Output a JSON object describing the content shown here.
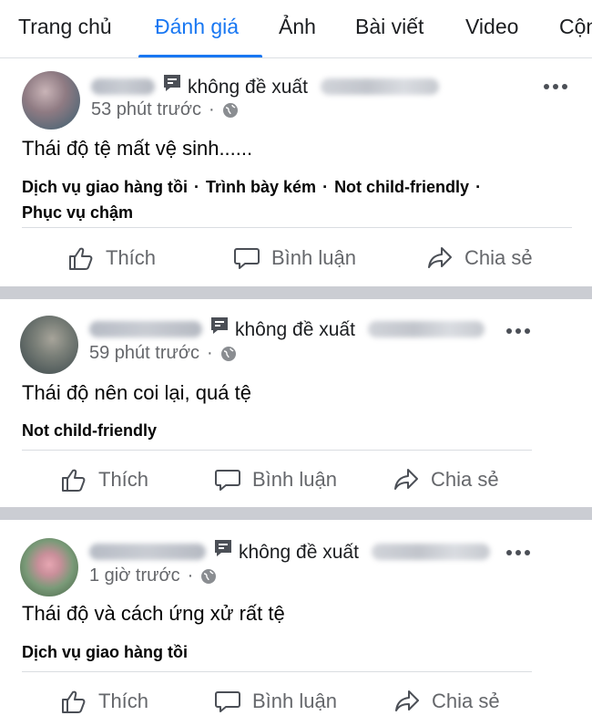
{
  "tabs": [
    {
      "label": "Trang chủ"
    },
    {
      "label": "Đánh giá",
      "active": true
    },
    {
      "label": "Ảnh"
    },
    {
      "label": "Bài viết"
    },
    {
      "label": "Video"
    },
    {
      "label": "Cộn"
    }
  ],
  "colors": {
    "accent": "#1877f2",
    "separator": "#cbcdd3",
    "secondary_text": "#65676b"
  },
  "posts": [
    {
      "recommendation": "không đề xuất",
      "time": "53 phút trước",
      "text": "Thái độ tệ mất vệ sinh......",
      "tags": [
        "Dịch vụ giao hàng tồi",
        "Trình bày kém",
        "Not child-friendly",
        "Phục vụ chậm"
      ],
      "actions": {
        "like": "Thích",
        "comment": "Bình luận",
        "share": "Chia sẻ"
      }
    },
    {
      "recommendation": "không đề xuất",
      "time": "59 phút trước",
      "text": "Thái độ nên coi lại, quá tệ",
      "tags": [
        "Not child-friendly"
      ],
      "actions": {
        "like": "Thích",
        "comment": "Bình luận",
        "share": "Chia sẻ"
      }
    },
    {
      "recommendation": "không đề xuất",
      "time": "1 giờ trước",
      "text": "Thái độ và cách ứng xử rất tệ",
      "tags": [
        "Dịch vụ giao hàng tồi"
      ],
      "actions": {
        "like": "Thích",
        "comment": "Bình luận",
        "share": "Chia sẻ"
      }
    }
  ]
}
